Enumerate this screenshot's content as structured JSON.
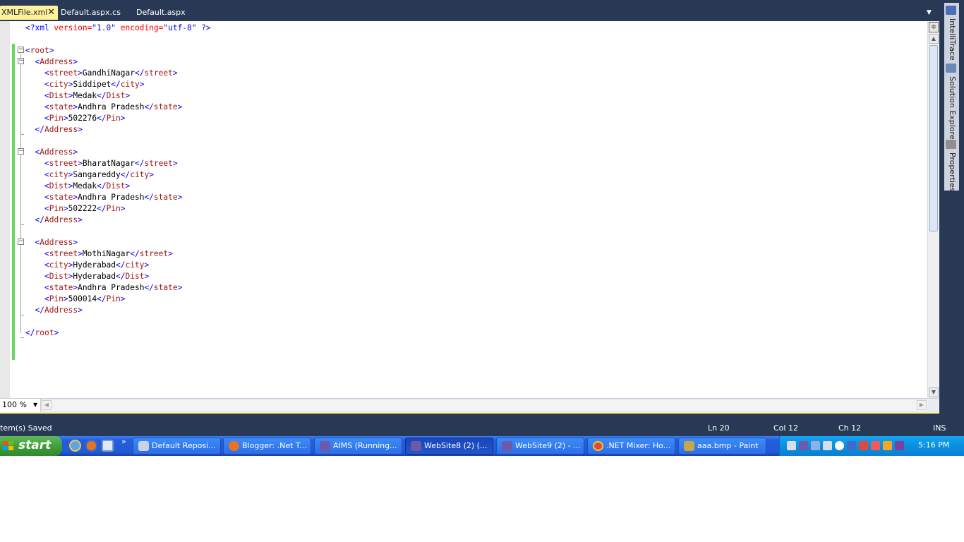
{
  "tabs": [
    {
      "label": "XMLFile.xml",
      "active": true,
      "close": "✕"
    },
    {
      "label": "Default.aspx.cs",
      "active": false
    },
    {
      "label": "Default.aspx",
      "active": false
    }
  ],
  "tab_dropdown": "▼",
  "editor": {
    "declaration": {
      "open": "<?xml ",
      "attr1": "version=",
      "val1": "\"1.0\"",
      "attr2": " encoding=",
      "val2": "\"utf-8\"",
      "close": " ?>"
    },
    "root_tag": "root",
    "addresses": [
      {
        "street": "GandhiNagar",
        "city": "Siddipet",
        "dist": "Medak",
        "state": "Andhra Pradesh",
        "pin": "502276"
      },
      {
        "street": "BharatNagar",
        "city": "Sangareddy",
        "dist": "Medak",
        "state": "Andhra Pradesh",
        "pin": "502222"
      },
      {
        "street": "MothiNagar",
        "city": "Hyderabad",
        "dist": "Hyderabad",
        "state": "Andhra Pradesh",
        "pin": "500014"
      }
    ],
    "zoom": "100 %"
  },
  "dock": {
    "items": [
      {
        "label": "IntelliTrace",
        "icon": "intellitrace-icon"
      },
      {
        "label": "Solution Explorer",
        "icon": "solution-explorer-icon"
      },
      {
        "label": "Properties",
        "icon": "properties-icon"
      }
    ]
  },
  "status": {
    "message": "tem(s) Saved",
    "ln": "Ln 20",
    "col": "Col 12",
    "ch": "Ch 12",
    "mode": "INS"
  },
  "taskbar": {
    "start_label": "start",
    "quicklaunch_more": "»",
    "buttons": [
      {
        "label": "Default Reposi...",
        "icon": "window-icon",
        "active": false
      },
      {
        "label": "Blogger: .Net T...",
        "icon": "firefox-icon",
        "active": false
      },
      {
        "label": "AIMS (Running...",
        "icon": "visual-studio-icon",
        "active": false
      },
      {
        "label": "WebSite8 (2) (...",
        "icon": "visual-studio-icon",
        "active": true
      },
      {
        "label": "WebSite9 (2) - ...",
        "icon": "visual-studio-icon",
        "active": false
      },
      {
        "label": ".NET Mixer: Ho...",
        "icon": "chrome-icon",
        "active": false
      },
      {
        "label": "aaa.bmp - Paint",
        "icon": "paint-icon",
        "active": false
      }
    ],
    "clock": "5:16 PM"
  },
  "colors": {
    "chrome": "#293955",
    "active_tab": "#fff29d",
    "change_bar": "#6cd464",
    "xml_tag": "#a31515",
    "xml_bracket": "#0000ff",
    "xml_attr": "#ff0000"
  }
}
